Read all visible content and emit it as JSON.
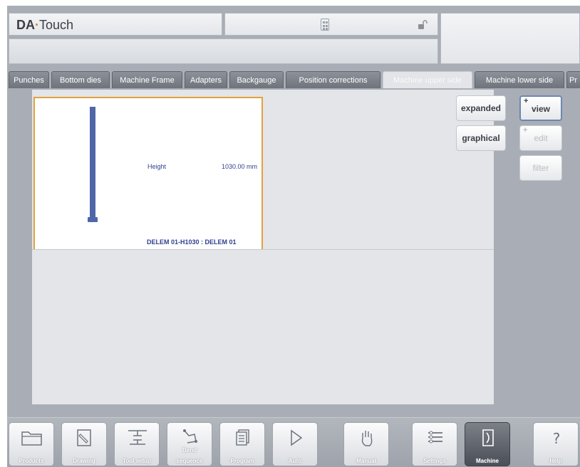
{
  "header": {
    "logo_brand": "DA",
    "logo_sep": "·",
    "logo_product": "Touch"
  },
  "tabs": [
    {
      "label": "Punches",
      "active": false
    },
    {
      "label": "Bottom dies",
      "active": false
    },
    {
      "label": "Machine Frame",
      "active": false
    },
    {
      "label": "Adapters",
      "active": false
    },
    {
      "label": "Backgauge",
      "active": false
    },
    {
      "label": "Position corrections",
      "active": false
    },
    {
      "label": "Machine upper side",
      "active": true
    },
    {
      "label": "Machine lower side",
      "active": false
    },
    {
      "label": "Pr",
      "active": false
    }
  ],
  "tool_card": {
    "height_label": "Height",
    "height_value": "1030.00 mm",
    "tool_name": "DELEM 01-H1030 : DELEM 01"
  },
  "actions": {
    "expanded": "expanded",
    "graphical": "graphical",
    "view": "view",
    "edit": "edit",
    "filter": "filter",
    "plus": "+"
  },
  "nav": {
    "products": "Products",
    "drawing": "Drawing",
    "tool_setup": "Tool setup",
    "bend_line1": "Bend",
    "bend_line2": "sequence",
    "program": "Program",
    "auto": "Auto",
    "manual": "Manual",
    "settings": "Settings",
    "machine": "Machine",
    "help": "Help"
  },
  "colors": {
    "accent_orange": "#e3a13c",
    "tool_blue": "#4f66a8",
    "label_blue": "#2f3f8f"
  }
}
